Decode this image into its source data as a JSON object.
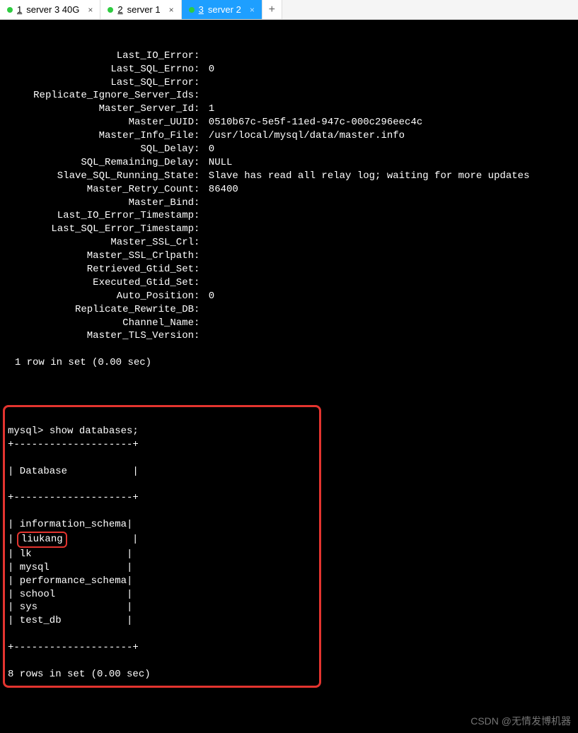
{
  "tabs": [
    {
      "num": "1",
      "label": "server 3 40G",
      "dot": "green",
      "active": false,
      "closable": true
    },
    {
      "num": "2",
      "label": "server 1",
      "dot": "green",
      "active": false,
      "closable": true
    },
    {
      "num": "3",
      "label": "server 2",
      "dot": "green",
      "active": true,
      "closable": true
    }
  ],
  "add_tab": "+",
  "status_lines": [
    {
      "key": "Last_IO_Error",
      "val": ""
    },
    {
      "key": "Last_SQL_Errno",
      "val": "0"
    },
    {
      "key": "Last_SQL_Error",
      "val": ""
    },
    {
      "key": "Replicate_Ignore_Server_Ids",
      "val": ""
    },
    {
      "key": "Master_Server_Id",
      "val": "1"
    },
    {
      "key": "Master_UUID",
      "val": "0510b67c-5e5f-11ed-947c-000c296eec4c"
    },
    {
      "key": "Master_Info_File",
      "val": "/usr/local/mysql/data/master.info"
    },
    {
      "key": "SQL_Delay",
      "val": "0"
    },
    {
      "key": "SQL_Remaining_Delay",
      "val": "NULL"
    },
    {
      "key": "Slave_SQL_Running_State",
      "val": "Slave has read all relay log; waiting for more updates"
    },
    {
      "key": "Master_Retry_Count",
      "val": "86400"
    },
    {
      "key": "Master_Bind",
      "val": ""
    },
    {
      "key": "Last_IO_Error_Timestamp",
      "val": ""
    },
    {
      "key": "Last_SQL_Error_Timestamp",
      "val": ""
    },
    {
      "key": "Master_SSL_Crl",
      "val": ""
    },
    {
      "key": "Master_SSL_Crlpath",
      "val": ""
    },
    {
      "key": "Retrieved_Gtid_Set",
      "val": ""
    },
    {
      "key": "Executed_Gtid_Set",
      "val": ""
    },
    {
      "key": "Auto_Position",
      "val": "0"
    },
    {
      "key": "Replicate_Rewrite_DB",
      "val": ""
    },
    {
      "key": "Channel_Name",
      "val": ""
    },
    {
      "key": "Master_TLS_Version",
      "val": ""
    }
  ],
  "row_summary_1": "1 row in set (0.00 sec)",
  "prompt": "mysql> ",
  "command": "show databases;",
  "table_border": "+--------------------+",
  "table_header": "| Database           |",
  "databases": [
    {
      "name": "information_schema",
      "highlight": false
    },
    {
      "name": "liukang",
      "highlight": true
    },
    {
      "name": "lk",
      "highlight": false
    },
    {
      "name": "mysql",
      "highlight": false
    },
    {
      "name": "performance_schema",
      "highlight": false
    },
    {
      "name": "school",
      "highlight": false
    },
    {
      "name": "sys",
      "highlight": false
    },
    {
      "name": "test_db",
      "highlight": false
    }
  ],
  "row_summary_2": "8 rows in set (0.00 sec)",
  "watermark": "CSDN @无情发博机器"
}
